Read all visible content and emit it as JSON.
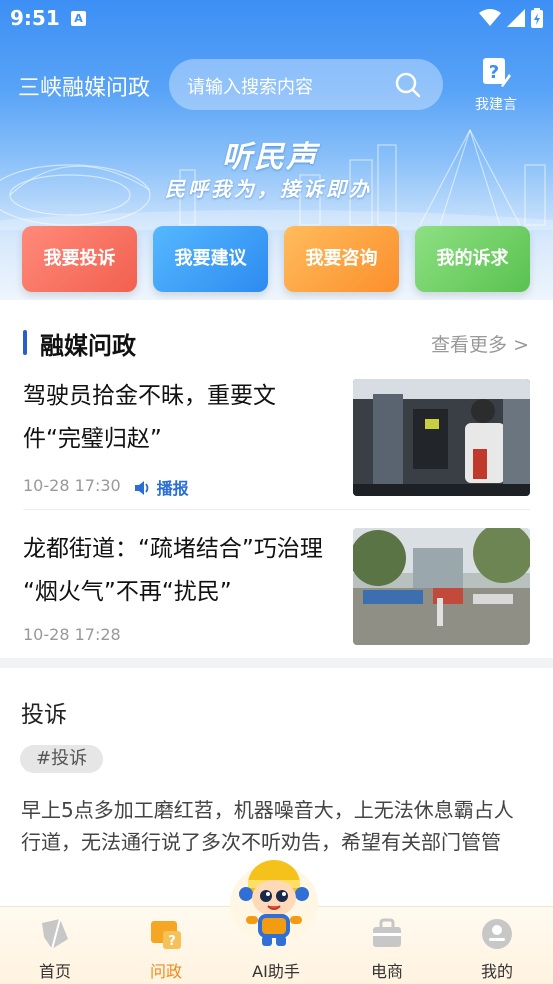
{
  "status_bar": {
    "time": "9:51"
  },
  "header": {
    "app_title": "三峡融媒问政",
    "search_placeholder": "请输入搜索内容",
    "suggest_label": "我建言"
  },
  "banner": {
    "slogan_main": "听民声",
    "slogan_sub": "民呼我为，接诉即办"
  },
  "actions": [
    {
      "label": "我要投诉"
    },
    {
      "label": "我要建议"
    },
    {
      "label": "我要咨询"
    },
    {
      "label": "我的诉求"
    }
  ],
  "news_section": {
    "title": "融媒问政",
    "more_label": "查看更多 >",
    "items": [
      {
        "title": "驾驶员拾金不昧，重要文件“完璧归赵”",
        "time": "10-28 17:30",
        "play_label": "播报"
      },
      {
        "title": "龙都街道：“疏堵结合”巧治理 “烟火气”不再“扰民”",
        "time": "10-28 17:28"
      }
    ]
  },
  "complaint": {
    "title": "投诉",
    "tag": "#投诉",
    "body": "早上5点多加工磨红苕，机器噪音大，上无法休息霸占人行道，无法通行说了多次不听劝告，希望有关部门管管"
  },
  "tabbar": {
    "items": [
      {
        "label": "首页",
        "icon": "home-icon",
        "active": false
      },
      {
        "label": "问政",
        "icon": "inquiry-icon",
        "active": true
      },
      {
        "label": "AI助手",
        "icon": "ai-assistant-icon",
        "active": false
      },
      {
        "label": "电商",
        "icon": "shop-bag-icon",
        "active": false
      },
      {
        "label": "我的",
        "icon": "profile-icon",
        "active": false
      }
    ]
  },
  "colors": {
    "primary": "#3d8ff5",
    "active_tab": "#f08a1a",
    "section_bar": "#2a5fc9"
  }
}
